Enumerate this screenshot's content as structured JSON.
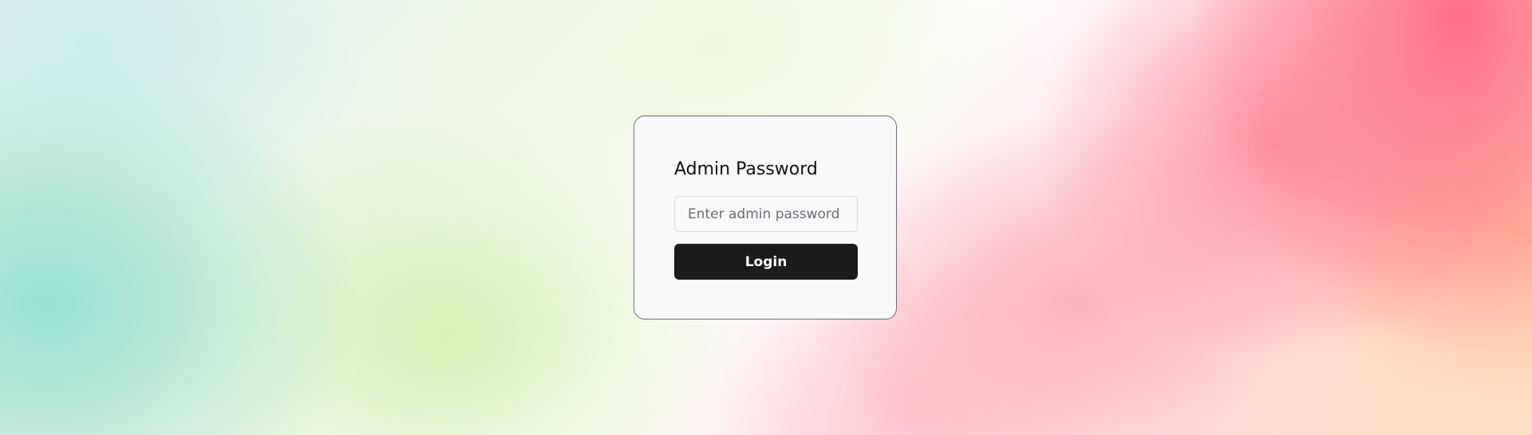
{
  "login_form": {
    "title": "Admin Password",
    "password_placeholder": "Enter admin password",
    "password_value": "",
    "login_label": "Login"
  },
  "colors": {
    "card_background": "#f8f9fb",
    "card_border": "#6e6e73",
    "button_background": "#1b1b1d",
    "button_text": "#ffffff"
  }
}
